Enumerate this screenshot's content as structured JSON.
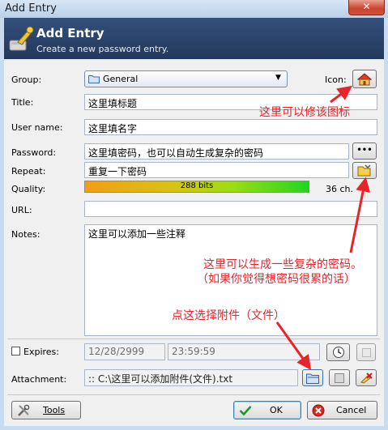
{
  "window": {
    "title": "Add Entry",
    "close_glyph": "✕"
  },
  "banner": {
    "title": "Add Entry",
    "subtitle": "Create a new password entry."
  },
  "form": {
    "group_label": "Group:",
    "group_value": "General",
    "icon_label": "Icon:",
    "title_label": "Title:",
    "title_value": "这里填标题",
    "username_label": "User name:",
    "username_value": "这里填名字",
    "password_label": "Password:",
    "password_value": "这里填密码，也可以自动生成复杂的密码",
    "password_toggle": "•••",
    "repeat_label": "Repeat:",
    "repeat_value": "重复一下密码",
    "quality_label": "Quality:",
    "quality_bits": "288 bits",
    "quality_fraction": 1.0,
    "quality_chars": "36 ch.",
    "url_label": "URL:",
    "url_value": "",
    "notes_label": "Notes:",
    "notes_value": "这里可以添加一些注释",
    "expires_label": "Expires:",
    "expires_date": "12/28/2999",
    "expires_time": "23:59:59",
    "attachment_label": "Attachment:",
    "attachment_value": ":: C:\\这里可以添加附件(文件).txt"
  },
  "buttons": {
    "tools": "Tools",
    "ok": "OK",
    "cancel": "Cancel"
  },
  "annotations": {
    "icon_note": "这里可以修该图标",
    "generate_note_1": "这里可以生成一些复杂的密码。",
    "generate_note_2": "（如果你觉得想密码很累的话）",
    "attach_note": "点这选择附件（文件）"
  },
  "colors": {
    "annotation": "#e8232b",
    "banner": "#2c4568",
    "quality_bar": "#2bd61e"
  }
}
